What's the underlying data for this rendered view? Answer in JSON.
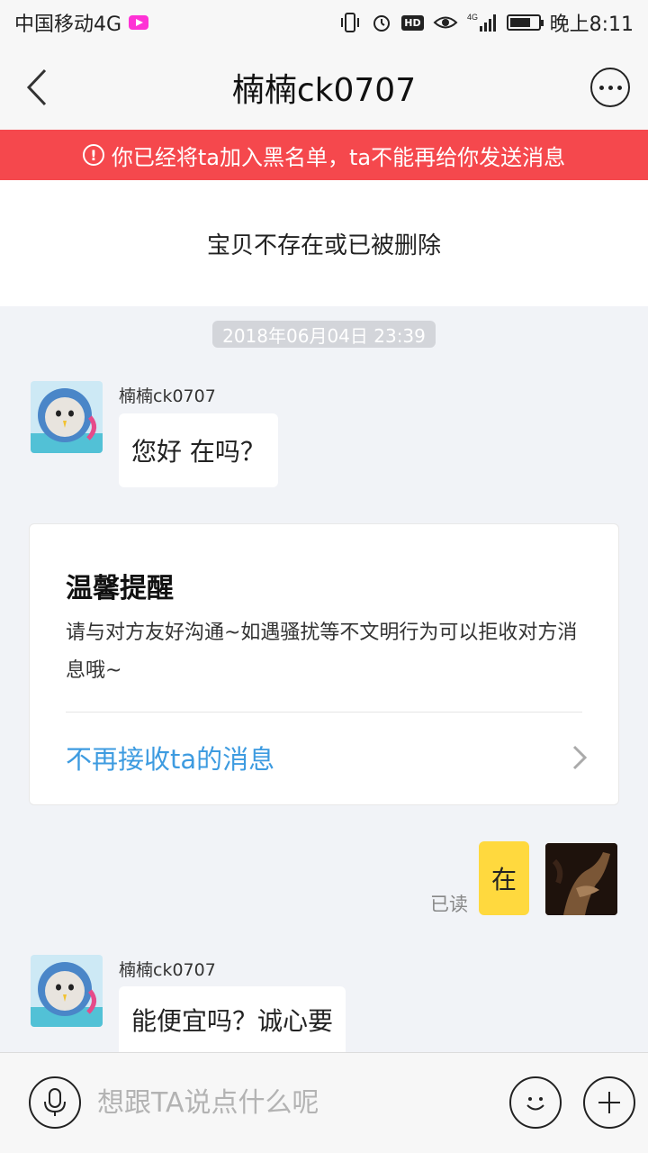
{
  "status_bar": {
    "carrier": "中国移动4G",
    "time": "晚上8:11",
    "hd_label": "HD",
    "network_label": "4G",
    "battery_level": 0.75,
    "icons": [
      "video-app-icon",
      "vibrate-icon",
      "alarm-icon",
      "hd-icon",
      "eye-icon",
      "signal-icon",
      "battery-icon"
    ]
  },
  "nav": {
    "title": "楠楠ck0707",
    "icons": [
      "back-arrow-icon",
      "more-icon"
    ]
  },
  "banner": {
    "text": "你已经将ta加入黑名单，ta不能再给你发送消息",
    "color": "#f5484d",
    "icon": "warning-icon"
  },
  "item_panel": {
    "text": "宝贝不存在或已被删除"
  },
  "conversation": {
    "timestamp": "2018年06月04日 23:39",
    "messages": [
      {
        "sender": "楠楠ck0707",
        "text": "您好 在吗？",
        "direction": "in"
      },
      {
        "sender": "",
        "text": "在",
        "direction": "out",
        "status": "已读"
      },
      {
        "sender": "楠楠ck0707",
        "text": "能便宜吗？诚心要",
        "direction": "in"
      }
    ]
  },
  "tip_card": {
    "title": "温馨提醒",
    "body": "请与对方友好沟通~如遇骚扰等不文明行为可以拒收对方消息哦~",
    "action": "不再接收ta的消息",
    "action_color": "#3d9be0"
  },
  "input_bar": {
    "placeholder": "想跟TA说点什么呢",
    "icons": [
      "microphone-icon",
      "emoji-icon",
      "plus-icon"
    ]
  },
  "colors": {
    "outgoing_bubble": "#ffd93e",
    "background": "#f1f3f7"
  }
}
